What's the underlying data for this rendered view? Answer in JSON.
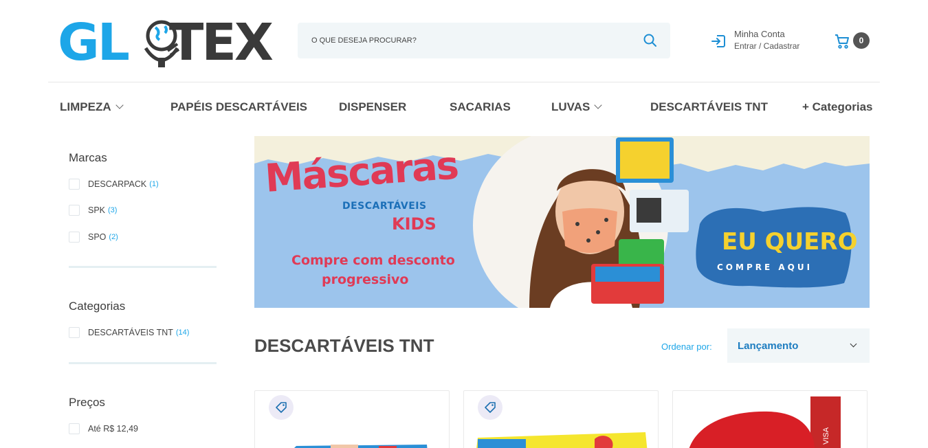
{
  "header": {
    "logo_text_left": "GL",
    "logo_text_right": "TEX",
    "search": {
      "placeholder": "O QUE DESEJA PROCURAR?"
    },
    "account": {
      "title": "Minha Conta",
      "subtitle": "Entrar / Cadastrar"
    },
    "cart": {
      "count": "0"
    }
  },
  "nav": [
    {
      "label": "LIMPEZA",
      "has_dropdown": true
    },
    {
      "label": "PAPÉIS DESCARTÁVEIS",
      "has_dropdown": false
    },
    {
      "label": "DISPENSER",
      "has_dropdown": false
    },
    {
      "label": "SACARIAS",
      "has_dropdown": false
    },
    {
      "label": "LUVAS",
      "has_dropdown": true
    },
    {
      "label": "DESCARTÁVEIS TNT",
      "has_dropdown": false
    },
    {
      "label": "+ Categorias",
      "has_dropdown": false
    }
  ],
  "sidebar": {
    "brands": {
      "title": "Marcas",
      "items": [
        {
          "label": "DESCARPACK",
          "count": "(1)"
        },
        {
          "label": "SPK",
          "count": "(3)"
        },
        {
          "label": "SPO",
          "count": "(2)"
        }
      ]
    },
    "categories": {
      "title": "Categorias",
      "items": [
        {
          "label": "DESCARTÁVEIS TNT",
          "count": "(14)"
        }
      ]
    },
    "prices": {
      "title": "Preços",
      "items": [
        {
          "label": "Até R$ 12,49"
        }
      ]
    }
  },
  "banner": {
    "title": "Máscaras",
    "subtitle": "DESCARTÁVEIS",
    "kids": "KIDS",
    "promo_line1": "Compre com desconto",
    "promo_line2": "progressivo",
    "cta_title": "EU QUERO",
    "cta_sub": "COMPRE AQUI",
    "colors": {
      "background": "#9cc4ec",
      "pink": "#e03a55",
      "cta_blue": "#2c6fb5",
      "cta_yellow": "#f5d12e"
    }
  },
  "listing": {
    "heading": "DESCARTÁVEIS TNT",
    "sort_label": "Ordenar por:",
    "sort_value": "Lançamento"
  },
  "products": [
    {
      "has_tag_badge": true
    },
    {
      "has_tag_badge": true
    },
    {
      "has_tag_badge": false
    }
  ],
  "colors": {
    "accent": "#1da6e8",
    "text": "#3d3d3d",
    "field_bg": "#f1f6f8"
  }
}
